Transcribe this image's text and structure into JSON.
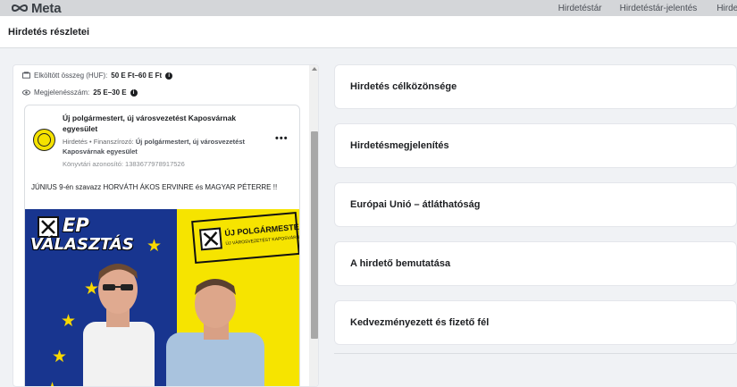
{
  "topbar": {
    "brand": "Meta",
    "nav": [
      "Hirdetéstár",
      "Hirdetéstár-jelentés",
      "Hirdet"
    ]
  },
  "modal": {
    "title": "Hirdetés részletei"
  },
  "stats": {
    "spend_label": "Elköltött összeg (HUF):",
    "spend_value": "50 E Ft–60 E Ft",
    "impressions_label": "Megjelenésszám:",
    "impressions_value": "25 E–30 E"
  },
  "ad": {
    "page_name": "Új polgármestert, új városvezetést Kaposvárnak egyesület",
    "type_label": "Hirdetés",
    "sponsor_prefix": "Finanszírozó:",
    "sponsor": "Új polgármestert, új városvezetést Kaposvárnak egyesület",
    "library_id": "Könyvtári azonosító: 1383677978917526",
    "more": "•••",
    "text": "JÚNIUS 9-én szavazz HORVÁTH ÁKOS ERVINRE és MAGYAR PÉTERRE !!",
    "creative": {
      "title_line1": "EP",
      "title_line2": "VÁLASZTÁS",
      "stamp_line1": "ÚJ POLGÁRMESTERT",
      "stamp_line2": "ÚJ VÁROSVEZETÉST KAPOSVÁRNAK"
    }
  },
  "sections": [
    "Hirdetés célközönsége",
    "Hirdetésmegjelenítés",
    "Európai Unió – átláthatóság",
    "A hirdető bemutatása",
    "Kedvezményezett és fizető fél"
  ],
  "colors": {
    "flag_blue": "#18358f",
    "flag_yellow": "#f6e400",
    "page_bg": "#f0f2f5"
  }
}
